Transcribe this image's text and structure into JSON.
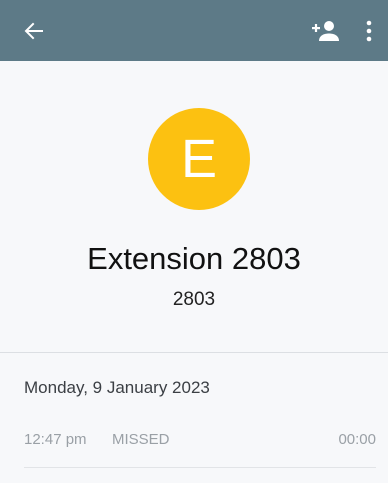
{
  "colors": {
    "appbar": "#5d7a87",
    "avatar": "#fcc111",
    "background": "#f7f8fa"
  },
  "toolbar": {
    "back_icon": "arrow-left-icon",
    "add_contact_icon": "add-person-icon",
    "more_icon": "more-vertical-icon"
  },
  "contact": {
    "initial": "E",
    "name": "Extension 2803",
    "number": "2803"
  },
  "history": {
    "date": "Monday, 9 January 2023",
    "calls": [
      {
        "time": "12:47 pm",
        "status": "MISSED",
        "duration": "00:00"
      }
    ]
  }
}
